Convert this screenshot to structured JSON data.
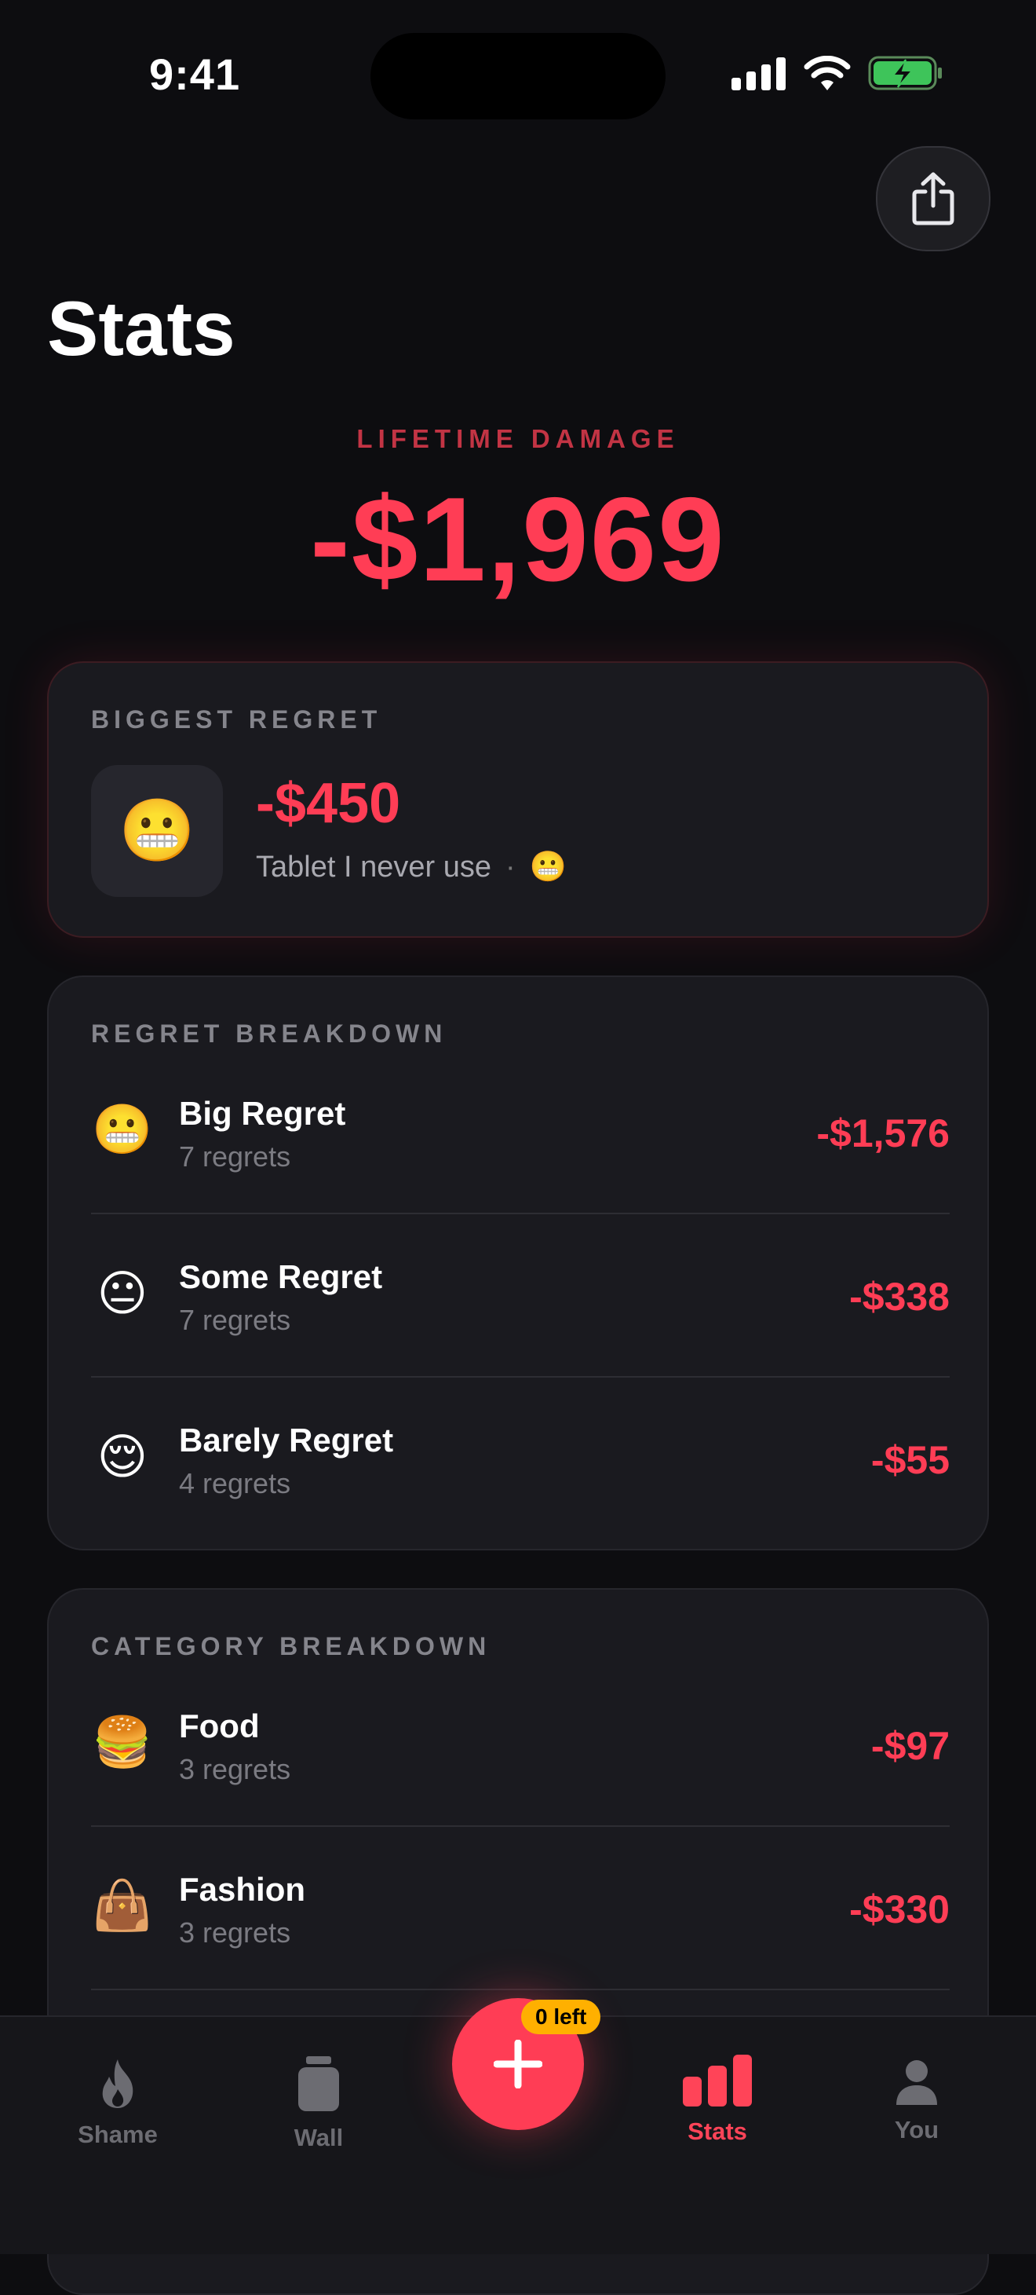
{
  "status_bar": {
    "time": "9:41"
  },
  "page": {
    "title": "Stats"
  },
  "lifetime": {
    "label": "LIFETIME DAMAGE",
    "value": "-$1,969"
  },
  "biggest_regret": {
    "label": "BIGGEST REGRET",
    "emoji": "😬",
    "amount": "-$450",
    "description": "Tablet I never use",
    "separator": "·",
    "level_emoji": "😬"
  },
  "regret_breakdown": {
    "label": "REGRET BREAKDOWN",
    "rows": [
      {
        "emoji": "😬",
        "name": "Big Regret",
        "count": "7 regrets",
        "amount": "-$1,576"
      },
      {
        "emoji": "😐",
        "name": "Some Regret",
        "count": "7 regrets",
        "amount": "-$338"
      },
      {
        "emoji": "😌",
        "name": "Barely Regret",
        "count": "4 regrets",
        "amount": "-$55"
      }
    ]
  },
  "category_breakdown": {
    "label": "CATEGORY BREAKDOWN",
    "rows": [
      {
        "emoji": "🍔",
        "name": "Food",
        "count": "3 regrets",
        "amount": "-$97"
      },
      {
        "emoji": "👜",
        "name": "Fashion",
        "count": "3 regrets",
        "amount": "-$330"
      }
    ]
  },
  "tab_bar": {
    "tabs": [
      {
        "label": "Shame",
        "icon": "flame-icon",
        "active": false
      },
      {
        "label": "Wall",
        "icon": "jar-icon",
        "active": false
      },
      {
        "label": "Stats",
        "icon": "bar-chart-icon",
        "active": true
      },
      {
        "label": "You",
        "icon": "person-icon",
        "active": false
      }
    ],
    "add_badge": "0 left"
  },
  "colors": {
    "accent": "#ff3d55",
    "badge": "#ffb000",
    "background": "#0d0d10",
    "card": "#1a1a1f"
  }
}
